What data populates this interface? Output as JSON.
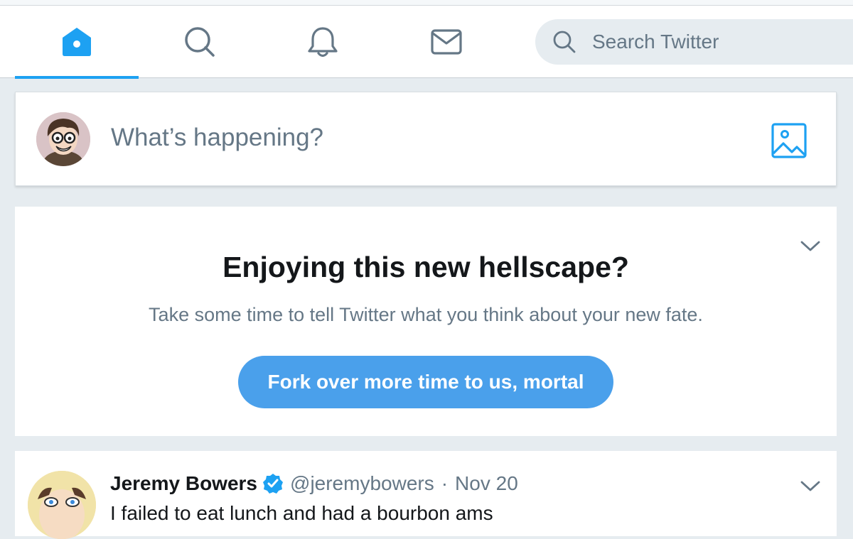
{
  "nav": {
    "tabs": [
      {
        "icon": "home-icon",
        "active": true
      },
      {
        "icon": "explore-search-icon",
        "active": false
      },
      {
        "icon": "notifications-bell-icon",
        "active": false
      },
      {
        "icon": "messages-envelope-icon",
        "active": false
      }
    ],
    "search_placeholder": "Search Twitter"
  },
  "compose": {
    "placeholder": "What’s happening?",
    "media_icon": "image-icon"
  },
  "prompt_card": {
    "title": "Enjoying this new hellscape?",
    "subtitle": "Take some time to tell Twitter what you think about your new fate.",
    "cta_label": "Fork over more time to us, mortal"
  },
  "tweet": {
    "name": "Jeremy Bowers",
    "handle": "@jeremybowers",
    "separator": "·",
    "date": "Nov 20",
    "text": "I failed to eat lunch and had a bourbon ams"
  },
  "colors": {
    "accent": "#1da1f2",
    "cta": "#4aa0eb",
    "secondary_text": "#657786",
    "background": "#e6ecf0"
  }
}
